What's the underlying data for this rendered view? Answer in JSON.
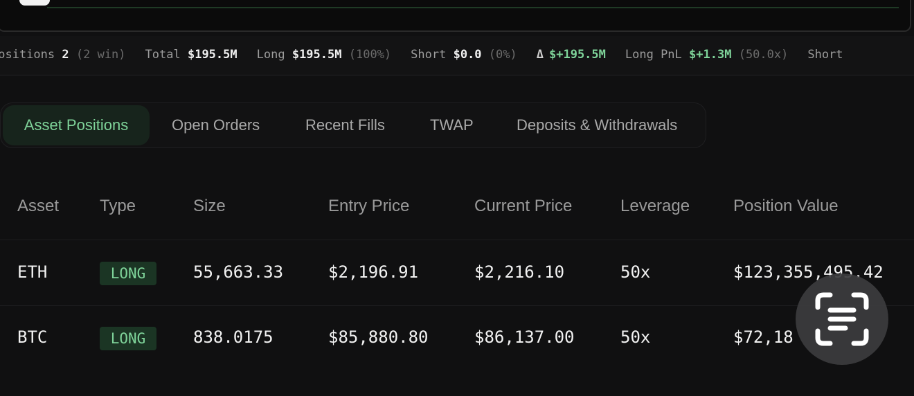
{
  "stats": {
    "positions": {
      "label": "Positions",
      "value": "2",
      "sub": "(2 win)"
    },
    "total": {
      "label": "Total",
      "value": "$195.5M"
    },
    "long": {
      "label": "Long",
      "value": "$195.5M",
      "sub": "(100%)"
    },
    "short": {
      "label": "Short",
      "value": "$0.0",
      "sub": "(0%)"
    },
    "delta": {
      "symbol": "Δ",
      "value": "$+195.5M"
    },
    "long_pnl": {
      "label": "Long PnL",
      "value": "$+1.3M",
      "sub": "(50.0x)"
    },
    "short_pnl": {
      "label": "Short"
    }
  },
  "tabs": [
    {
      "label": "Asset Positions",
      "active": true
    },
    {
      "label": "Open Orders",
      "active": false
    },
    {
      "label": "Recent Fills",
      "active": false
    },
    {
      "label": "TWAP",
      "active": false
    },
    {
      "label": "Deposits & Withdrawals",
      "active": false
    }
  ],
  "table": {
    "headers": [
      "Asset",
      "Type",
      "Size",
      "Entry Price",
      "Current Price",
      "Leverage",
      "Position Value"
    ],
    "rows": [
      {
        "asset": "ETH",
        "type": "LONG",
        "size": "55,663.33",
        "entry_price": "$2,196.91",
        "current_price": "$2,216.10",
        "leverage": "50x",
        "position_value": "$123,355,495.42"
      },
      {
        "asset": "BTC",
        "type": "LONG",
        "size": "838.0175",
        "entry_price": "$85,880.80",
        "current_price": "$86,137.00",
        "leverage": "50x",
        "position_value": "$72,18"
      }
    ]
  },
  "colors": {
    "accent_green": "#7fd49a",
    "background": "#101011",
    "badge_bg": "#1b3524"
  },
  "overlay": {
    "icon": "text-scan-icon"
  }
}
